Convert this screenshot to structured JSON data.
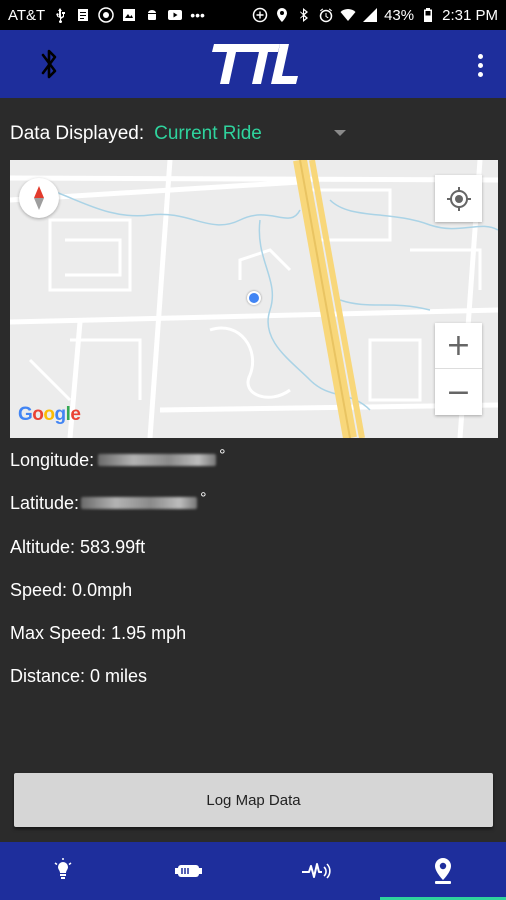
{
  "status_bar": {
    "carrier": "AT&T",
    "battery_percent": "43%",
    "time": "2:31 PM"
  },
  "app_bar": {
    "logo_text": "TTL",
    "bluetooth_icon": "bluetooth-icon",
    "menu_icon": "overflow-menu-icon"
  },
  "selector": {
    "label": "Data Displayed:",
    "value": "Current Ride"
  },
  "map": {
    "google_letters": [
      "G",
      "o",
      "o",
      "g",
      "l",
      "e"
    ],
    "zoom_in": "+",
    "zoom_out": "−"
  },
  "info": {
    "longitude_label": "Longitude:",
    "latitude_label": "Latitude:",
    "degree_symbol": "°",
    "altitude": "Altitude: 583.99ft",
    "speed": "Speed: 0.0mph",
    "max_speed": "Max Speed: 1.95 mph",
    "distance": "Distance: 0 miles"
  },
  "log_button": {
    "label": "Log Map Data"
  },
  "bottom_nav": {
    "items": [
      {
        "icon": "light-bulb-icon"
      },
      {
        "icon": "battery-device-icon"
      },
      {
        "icon": "vibration-pulse-icon"
      },
      {
        "icon": "map-pin-icon"
      }
    ],
    "active_index": 3
  },
  "colors": {
    "brand_blue": "#1e2e9c",
    "accent_green": "#2fd39d",
    "background": "#2b2b2b"
  }
}
